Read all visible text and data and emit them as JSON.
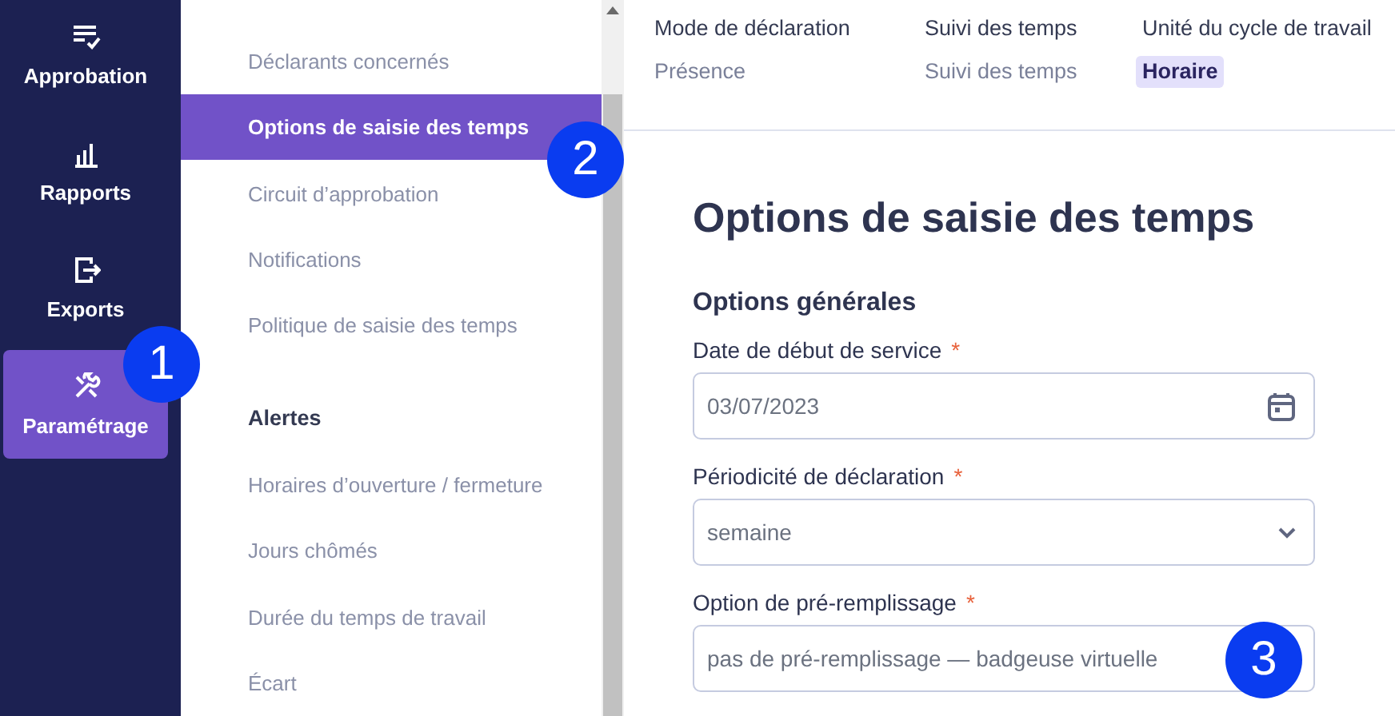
{
  "nav": {
    "items": [
      {
        "label": "Approbation",
        "selected": false
      },
      {
        "label": "Rapports",
        "selected": false
      },
      {
        "label": "Exports",
        "selected": false
      },
      {
        "label": "Paramétrage",
        "selected": true
      }
    ]
  },
  "menu": {
    "items": [
      {
        "kind": "link",
        "label": "Déclarants concernés",
        "selected": false
      },
      {
        "kind": "link",
        "label": "Options de saisie des temps",
        "selected": true
      },
      {
        "kind": "link",
        "label": "Circuit d’approbation",
        "selected": false
      },
      {
        "kind": "link",
        "label": "Notifications",
        "selected": false
      },
      {
        "kind": "link",
        "label": "Politique de saisie des temps",
        "selected": false
      },
      {
        "kind": "section",
        "label": "Alertes"
      },
      {
        "kind": "link",
        "label": "Horaires d’ouverture / fermeture",
        "selected": false
      },
      {
        "kind": "link",
        "label": "Jours chômés",
        "selected": false
      },
      {
        "kind": "link",
        "label": "Durée du temps de travail",
        "selected": false
      },
      {
        "kind": "link",
        "label": "Écart",
        "selected": false
      }
    ]
  },
  "summary": [
    {
      "label": "Mode de déclaration",
      "value": "Présence",
      "highlighted": false
    },
    {
      "label": "Suivi des temps",
      "value": "Suivi des temps",
      "highlighted": false
    },
    {
      "label": "Unité du cycle de travail",
      "value": "Horaire",
      "highlighted": true
    }
  ],
  "page": {
    "title": "Options de saisie des temps",
    "section": "Options générales",
    "fields": [
      {
        "kind": "date",
        "label": "Date de début de service",
        "required": "*",
        "value": "03/07/2023"
      },
      {
        "kind": "select",
        "label": "Périodicité de déclaration",
        "required": "*",
        "value": "semaine"
      },
      {
        "kind": "text",
        "label": "Option de pré-remplissage",
        "required": "*",
        "value": "pas de pré-remplissage — badgeuse virtuelle"
      }
    ]
  },
  "callouts": [
    {
      "number": "1"
    },
    {
      "number": "2"
    },
    {
      "number": "3"
    }
  ]
}
